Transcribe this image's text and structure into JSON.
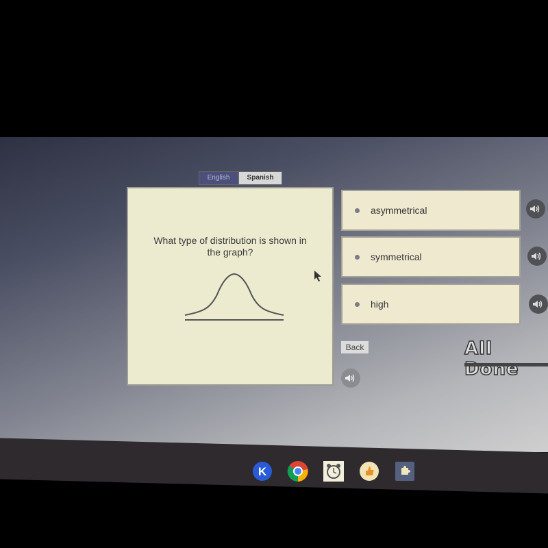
{
  "language_tabs": [
    {
      "label": "English",
      "active": true
    },
    {
      "label": "Spanish",
      "active": false
    }
  ],
  "question": {
    "text": "What type of distribution is shown in the graph?",
    "graph_icon": "bell-curve-icon"
  },
  "answers": [
    {
      "label": "asymmetrical",
      "speaker_icon": "speaker-icon"
    },
    {
      "label": "symmetrical",
      "speaker_icon": "speaker-icon"
    },
    {
      "label": "high",
      "speaker_icon": "speaker-icon"
    }
  ],
  "controls": {
    "back_label": "Back",
    "all_done_label": "All Done",
    "read_aloud_icon": "speaker-icon"
  },
  "dock": [
    {
      "name": "k-app-icon",
      "glyph": "K",
      "color": "#2a5bd7"
    },
    {
      "name": "chrome-icon",
      "glyph": "",
      "color": "#db4437"
    },
    {
      "name": "alarm-clock-icon",
      "glyph": "⏰",
      "color": "#f3efdc"
    },
    {
      "name": "thumbs-up-icon",
      "glyph": "👍",
      "color": "#f4e3b5"
    },
    {
      "name": "puzzle-extension-icon",
      "glyph": "✚",
      "color": "#556080"
    }
  ]
}
